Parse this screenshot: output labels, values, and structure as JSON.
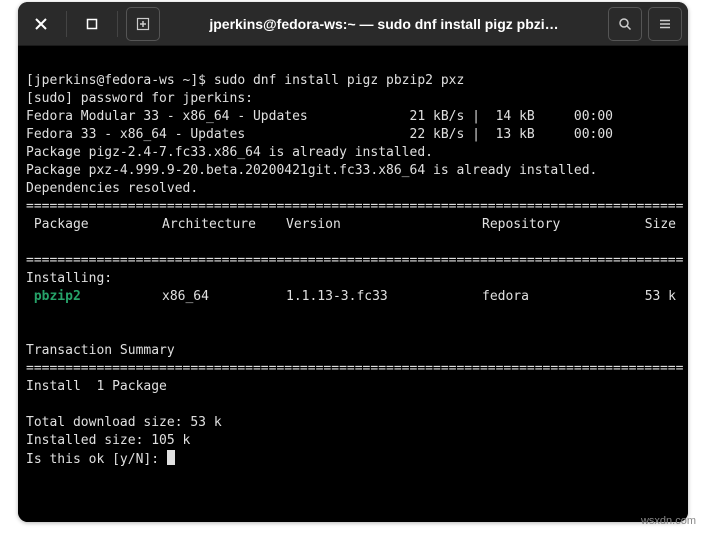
{
  "titlebar": {
    "title": "jperkins@fedora-ws:~ — sudo dnf install pigz pbzi…"
  },
  "terminal": {
    "prompt": "[jperkins@fedora-ws ~]$ ",
    "command": "sudo dnf install pigz pbzip2 pxz",
    "sudo_line": "[sudo] password for jperkins:",
    "repo_lines": [
      "Fedora Modular 33 - x86_64 - Updates             21 kB/s |  14 kB     00:00",
      "Fedora 33 - x86_64 - Updates                     22 kB/s |  13 kB     00:00"
    ],
    "already_installed": [
      "Package pigz-2.4-7.fc33.x86_64 is already installed.",
      "Package pxz-4.999.9-20.beta.20200421git.fc33.x86_64 is already installed."
    ],
    "deps_resolved": "Dependencies resolved.",
    "divider": "====================================================================================",
    "table": {
      "headers": {
        "package": " Package",
        "arch": "Architecture",
        "version": "Version",
        "repo": "Repository",
        "size": "Size"
      },
      "section": "Installing:",
      "rows": [
        {
          "name": " pbzip2",
          "arch": "x86_64",
          "version": "1.1.13-3.fc33",
          "repo": "fedora",
          "size": "53 k"
        }
      ]
    },
    "tx_summary": "Transaction Summary",
    "install_count": "Install  1 Package",
    "dl_size": "Total download size: 53 k",
    "inst_size": "Installed size: 105 k",
    "confirm": "Is this ok [y/N]: "
  },
  "watermark": "wsxdn.com"
}
